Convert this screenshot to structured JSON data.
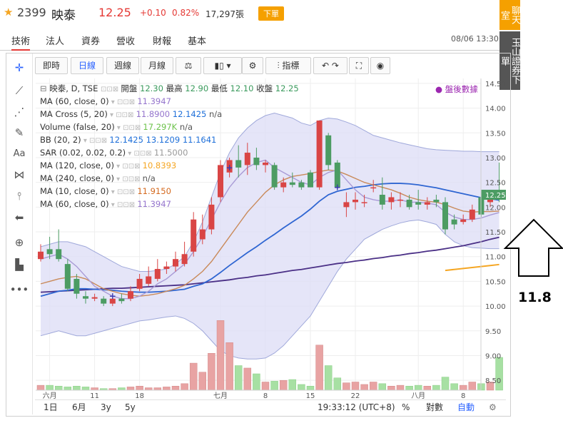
{
  "header": {
    "code": "2399",
    "name": "映泰",
    "price": "12.25",
    "change": "+0.10",
    "change_pct": "0.82%",
    "volume": "17,297張",
    "order_button": "下單"
  },
  "tabs": [
    "技術",
    "法人",
    "資券",
    "營收",
    "財報",
    "基本"
  ],
  "datetime": "08/06 13:30",
  "side_buttons": [
    "聊天室",
    "玉山證券下單"
  ],
  "toolbar": {
    "buttons": [
      "即時",
      "日線",
      "週線",
      "月線",
      "指標"
    ],
    "active": "日線"
  },
  "left_tools": [
    "cursor-cross-icon",
    "trend-line-icon",
    "fib-icon",
    "brush-icon",
    "Aa",
    "pattern-icon",
    "measure-icon",
    "arrow-left-icon",
    "zoom-in-icon",
    "ruler-icon",
    "more-icon"
  ],
  "legend": {
    "title": "映泰, D, TSE",
    "ohlc": [
      [
        "開盤",
        "12.30"
      ],
      [
        "最高",
        "12.90"
      ],
      [
        "最低",
        "12.10"
      ],
      [
        "收盤",
        "12.25"
      ]
    ],
    "after_hours": "盤後數據",
    "rows": [
      {
        "label": "MA (60, close, 0)",
        "values": [
          "11.3947"
        ],
        "colors": [
          "#9575cd"
        ]
      },
      {
        "label": "MA Cross (5, 20)",
        "values": [
          "11.8900",
          "12.1425",
          "n/a"
        ],
        "colors": [
          "#9575cd",
          "#1e6fd9",
          "#555555"
        ]
      },
      {
        "label": "Volume (false, 20)",
        "values": [
          "17.297K",
          "n/a"
        ],
        "colors": [
          "#6cc24a",
          "#555555"
        ]
      },
      {
        "label": "BB (20, 2)",
        "values": [
          "12.1425",
          "13.1209",
          "11.1641"
        ],
        "colors": [
          "#1e6fd9",
          "#1e6fd9",
          "#1e6fd9"
        ]
      },
      {
        "label": "SAR (0.02, 0.02, 0.2)",
        "values": [
          "11.5000"
        ],
        "colors": [
          "#999999"
        ]
      },
      {
        "label": "MA (120, close, 0)",
        "values": [
          "10.8393"
        ],
        "colors": [
          "#f5a623"
        ]
      },
      {
        "label": "MA (240, close, 0)",
        "values": [
          "n/a"
        ],
        "colors": [
          "#555555"
        ]
      },
      {
        "label": "MA (10, close, 0)",
        "values": [
          "11.9150"
        ],
        "colors": [
          "#d4691e"
        ]
      },
      {
        "label": "MA (60, close, 0)",
        "values": [
          "11.3947"
        ],
        "colors": [
          "#9575cd"
        ]
      }
    ]
  },
  "bottom_bar": {
    "ranges": [
      "1日",
      "6月",
      "3y",
      "5y"
    ],
    "time": "19:33:12 (UTC+8)",
    "percent": "%",
    "log": "對數",
    "auto": "自動"
  },
  "annotation": {
    "value": "11.8"
  },
  "chart_data": {
    "type": "candlestick",
    "title": "映泰, D, TSE",
    "ylim": [
      8.3,
      14.6
    ],
    "y_ticks": [
      "14.50",
      "14.00",
      "13.50",
      "13.00",
      "12.50",
      "12.00",
      "11.50",
      "11.00",
      "10.50",
      "10.00",
      "9.50",
      "9.00",
      "8.50"
    ],
    "x_ticks": [
      {
        "label": "六月",
        "i": 1
      },
      {
        "label": "11",
        "i": 6
      },
      {
        "label": "18",
        "i": 11
      },
      {
        "label": "七月",
        "i": 20
      },
      {
        "label": "8",
        "i": 25
      },
      {
        "label": "15",
        "i": 30
      },
      {
        "label": "22",
        "i": 35
      },
      {
        "label": "八月",
        "i": 42
      },
      {
        "label": "8",
        "i": 47
      }
    ],
    "last_price": "12.25",
    "candles": [
      {
        "o": 10.95,
        "h": 11.25,
        "l": 10.9,
        "c": 11.1
      },
      {
        "o": 11.15,
        "h": 11.4,
        "l": 10.95,
        "c": 11.05
      },
      {
        "o": 11.15,
        "h": 11.55,
        "l": 10.9,
        "c": 10.95
      },
      {
        "o": 10.85,
        "h": 10.95,
        "l": 10.3,
        "c": 10.35
      },
      {
        "o": 10.55,
        "h": 10.65,
        "l": 10.15,
        "c": 10.25
      },
      {
        "o": 10.2,
        "h": 10.3,
        "l": 10.05,
        "c": 10.15
      },
      {
        "o": 10.15,
        "h": 10.25,
        "l": 10.1,
        "c": 10.18
      },
      {
        "o": 10.15,
        "h": 10.2,
        "l": 10.0,
        "c": 10.05
      },
      {
        "o": 10.05,
        "h": 10.2,
        "l": 10.0,
        "c": 10.15
      },
      {
        "o": 10.15,
        "h": 10.25,
        "l": 10.05,
        "c": 10.1
      },
      {
        "o": 10.15,
        "h": 10.4,
        "l": 10.1,
        "c": 10.3
      },
      {
        "o": 10.35,
        "h": 10.65,
        "l": 10.3,
        "c": 10.55
      },
      {
        "o": 10.45,
        "h": 10.8,
        "l": 10.4,
        "c": 10.6
      },
      {
        "o": 10.55,
        "h": 10.95,
        "l": 10.5,
        "c": 10.75
      },
      {
        "o": 10.75,
        "h": 10.9,
        "l": 10.65,
        "c": 10.8
      },
      {
        "o": 10.8,
        "h": 11.1,
        "l": 10.7,
        "c": 10.95
      },
      {
        "o": 10.85,
        "h": 11.3,
        "l": 10.8,
        "c": 11.05
      },
      {
        "o": 11.1,
        "h": 11.9,
        "l": 11.0,
        "c": 11.75
      },
      {
        "o": 11.35,
        "h": 11.85,
        "l": 11.25,
        "c": 11.55
      },
      {
        "o": 11.55,
        "h": 12.2,
        "l": 11.45,
        "c": 12.05
      },
      {
        "o": 12.2,
        "h": 12.95,
        "l": 12.1,
        "c": 12.85
      },
      {
        "o": 12.7,
        "h": 13.0,
        "l": 12.6,
        "c": 12.95
      },
      {
        "o": 12.95,
        "h": 13.25,
        "l": 12.6,
        "c": 12.8
      },
      {
        "o": 12.85,
        "h": 13.3,
        "l": 12.65,
        "c": 13.1
      },
      {
        "o": 13.0,
        "h": 13.2,
        "l": 12.75,
        "c": 12.85
      },
      {
        "o": 12.85,
        "h": 12.95,
        "l": 12.7,
        "c": 12.9
      },
      {
        "o": 12.85,
        "h": 12.9,
        "l": 12.35,
        "c": 12.4
      },
      {
        "o": 12.4,
        "h": 12.6,
        "l": 12.3,
        "c": 12.5
      },
      {
        "o": 12.5,
        "h": 12.7,
        "l": 12.4,
        "c": 12.45
      },
      {
        "o": 12.5,
        "h": 12.55,
        "l": 12.35,
        "c": 12.4
      },
      {
        "o": 12.7,
        "h": 12.75,
        "l": 12.4,
        "c": 12.4
      },
      {
        "o": 12.4,
        "h": 13.75,
        "l": 12.35,
        "c": 13.75
      },
      {
        "o": 13.45,
        "h": 13.5,
        "l": 12.75,
        "c": 12.85
      },
      {
        "o": 12.9,
        "h": 12.95,
        "l": 12.35,
        "c": 12.4
      },
      {
        "o": 12.0,
        "h": 12.3,
        "l": 11.8,
        "c": 12.1
      },
      {
        "o": 12.1,
        "h": 12.3,
        "l": 11.95,
        "c": 12.15
      },
      {
        "o": 12.1,
        "h": 12.25,
        "l": 12.0,
        "c": 12.1
      },
      {
        "o": 12.4,
        "h": 12.55,
        "l": 12.3,
        "c": 12.4
      },
      {
        "o": 12.25,
        "h": 12.6,
        "l": 11.95,
        "c": 12.05
      },
      {
        "o": 12.1,
        "h": 12.3,
        "l": 11.95,
        "c": 12.2
      },
      {
        "o": 12.15,
        "h": 12.3,
        "l": 12.0,
        "c": 12.15
      },
      {
        "o": 12.15,
        "h": 12.25,
        "l": 11.95,
        "c": 12.0
      },
      {
        "o": 12.1,
        "h": 12.35,
        "l": 11.95,
        "c": 12.05
      },
      {
        "o": 12.05,
        "h": 12.2,
        "l": 11.95,
        "c": 12.1
      },
      {
        "o": 12.15,
        "h": 12.25,
        "l": 12.0,
        "c": 12.1
      },
      {
        "o": 12.1,
        "h": 12.2,
        "l": 11.45,
        "c": 11.55
      },
      {
        "o": 11.75,
        "h": 11.85,
        "l": 11.55,
        "c": 11.65
      },
      {
        "o": 11.7,
        "h": 11.85,
        "l": 11.65,
        "c": 11.75
      },
      {
        "o": 11.75,
        "h": 12.05,
        "l": 11.7,
        "c": 11.95
      },
      {
        "o": 12.2,
        "h": 12.35,
        "l": 11.8,
        "c": 11.85
      },
      {
        "o": 12.1,
        "h": 12.35,
        "l": 12.0,
        "c": 12.15
      },
      {
        "o": 12.3,
        "h": 12.9,
        "l": 12.1,
        "c": 12.25
      }
    ],
    "volumes": [
      0.06,
      0.06,
      0.05,
      0.04,
      0.05,
      0.04,
      0.03,
      0.02,
      0.02,
      0.03,
      0.04,
      0.05,
      0.03,
      0.03,
      0.04,
      0.05,
      0.08,
      0.33,
      0.22,
      0.45,
      0.85,
      0.58,
      0.3,
      0.27,
      0.2,
      0.1,
      0.11,
      0.12,
      0.13,
      0.07,
      0.05,
      0.55,
      0.3,
      0.15,
      0.09,
      0.1,
      0.07,
      0.1,
      0.08,
      0.05,
      0.06,
      0.05,
      0.06,
      0.05,
      0.06,
      0.16,
      0.08,
      0.06,
      0.1,
      0.08,
      0.1,
      0.4
    ],
    "ma60": [
      10.28,
      10.29,
      10.3,
      10.31,
      10.32,
      10.33,
      10.34,
      10.35,
      10.36,
      10.36,
      10.37,
      10.38,
      10.39,
      10.4,
      10.41,
      10.42,
      10.43,
      10.45,
      10.47,
      10.49,
      10.51,
      10.53,
      10.56,
      10.58,
      10.61,
      10.63,
      10.66,
      10.69,
      10.72,
      10.74,
      10.77,
      10.8,
      10.83,
      10.86,
      10.88,
      10.91,
      10.93,
      10.96,
      10.98,
      11.01,
      11.03,
      11.06,
      11.08,
      11.11,
      11.13,
      11.16,
      11.19,
      11.22,
      11.26,
      11.3,
      11.35,
      11.39
    ],
    "ma20": [
      10.2,
      10.25,
      10.3,
      10.32,
      10.35,
      10.35,
      10.34,
      10.33,
      10.32,
      10.3,
      10.29,
      10.28,
      10.28,
      10.29,
      10.3,
      10.32,
      10.34,
      10.4,
      10.45,
      10.55,
      10.68,
      10.82,
      10.95,
      11.08,
      11.2,
      11.33,
      11.45,
      11.58,
      11.7,
      11.82,
      11.96,
      12.12,
      12.25,
      12.32,
      12.36,
      12.4,
      12.42,
      12.45,
      12.47,
      12.48,
      12.48,
      12.47,
      12.45,
      12.42,
      12.39,
      12.35,
      12.31,
      12.27,
      12.23,
      12.19,
      12.17,
      12.14
    ],
    "ma10": [
      10.45,
      10.5,
      10.55,
      10.58,
      10.6,
      10.55,
      10.45,
      10.35,
      10.3,
      10.25,
      10.22,
      10.2,
      10.22,
      10.25,
      10.3,
      10.35,
      10.42,
      10.55,
      10.7,
      10.9,
      11.15,
      11.4,
      11.65,
      11.9,
      12.1,
      12.3,
      12.45,
      12.55,
      12.62,
      12.65,
      12.68,
      12.72,
      12.75,
      12.73,
      12.66,
      12.58,
      12.5,
      12.45,
      12.4,
      12.35,
      12.28,
      12.2,
      12.15,
      12.12,
      12.1,
      12.05,
      11.98,
      11.92,
      11.9,
      11.91,
      11.91,
      11.92
    ],
    "ma5": [
      10.95,
      11.0,
      11.05,
      10.95,
      10.8,
      10.6,
      10.4,
      10.3,
      10.2,
      10.15,
      10.15,
      10.2,
      10.3,
      10.45,
      10.55,
      10.7,
      10.85,
      11.1,
      11.4,
      11.75,
      12.1,
      12.4,
      12.62,
      12.8,
      12.9,
      12.95,
      12.8,
      12.7,
      12.6,
      12.5,
      12.45,
      12.6,
      12.7,
      12.75,
      12.55,
      12.35,
      12.2,
      12.15,
      12.12,
      12.12,
      12.15,
      12.1,
      12.1,
      12.08,
      12.05,
      11.9,
      11.8,
      11.75,
      11.75,
      11.78,
      11.84,
      11.89
    ],
    "bb_upper": [
      11.2,
      11.25,
      11.3,
      11.3,
      11.25,
      11.2,
      11.1,
      11.0,
      10.9,
      10.8,
      10.75,
      10.7,
      10.7,
      10.72,
      10.75,
      10.85,
      11.0,
      11.3,
      11.7,
      12.2,
      12.7,
      13.1,
      13.4,
      13.6,
      13.75,
      13.85,
      13.9,
      13.85,
      13.8,
      13.7,
      13.65,
      13.75,
      13.8,
      13.78,
      13.72,
      13.65,
      13.55,
      13.45,
      13.4,
      13.35,
      13.3,
      13.26,
      13.22,
      13.18,
      13.16,
      13.15,
      13.14,
      13.13,
      13.13,
      13.12,
      13.12,
      13.12
    ],
    "bb_lower": [
      9.4,
      9.45,
      9.5,
      9.45,
      9.4,
      9.4,
      9.45,
      9.5,
      9.55,
      9.6,
      9.65,
      9.7,
      9.72,
      9.75,
      9.78,
      9.8,
      9.75,
      9.65,
      9.5,
      9.3,
      9.1,
      9.0,
      8.95,
      8.93,
      8.93,
      8.95,
      9.05,
      9.2,
      9.4,
      9.6,
      9.8,
      10.1,
      10.4,
      10.7,
      10.95,
      11.15,
      11.35,
      11.45,
      11.55,
      11.62,
      11.68,
      11.72,
      11.74,
      11.7,
      11.65,
      11.45,
      11.3,
      11.22,
      11.18,
      11.17,
      11.16,
      11.16
    ],
    "ma120_segment": {
      "start": 45,
      "values": [
        10.72,
        10.74,
        10.76,
        10.78,
        10.8,
        10.82,
        10.84
      ]
    },
    "sar_points": [
      {
        "i": 8,
        "v": 10.2
      },
      {
        "i": 21,
        "v": 12.8
      },
      {
        "i": 33,
        "v": 12.4
      }
    ]
  }
}
